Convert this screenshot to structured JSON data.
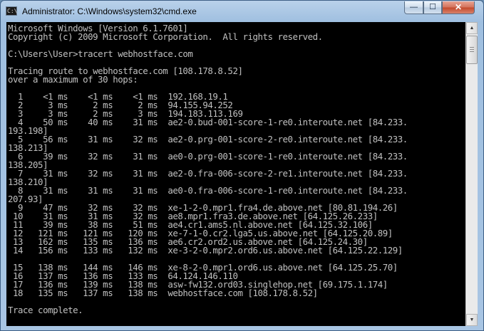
{
  "window": {
    "title": "Administrator: C:\\Windows\\system32\\cmd.exe",
    "icon": "cmd-icon",
    "controls": {
      "minimize": "—",
      "maximize": "☐",
      "close": "✕"
    }
  },
  "console": {
    "lines": [
      "Microsoft Windows [Version 6.1.7601]",
      "Copyright (c) 2009 Microsoft Corporation.  All rights reserved.",
      "",
      "C:\\Users\\User>tracert webhostface.com",
      "",
      "Tracing route to webhostface.com [108.178.8.52]",
      "over a maximum of 30 hops:",
      "",
      "  1    <1 ms    <1 ms    <1 ms  192.168.19.1",
      "  2     3 ms     2 ms     2 ms  94.155.94.252",
      "  3     3 ms     2 ms     3 ms  194.183.113.169",
      "  4    50 ms    40 ms    31 ms  ae2-0.bud-001-score-1-re0.interoute.net [84.233.",
      "193.198]",
      "  5    56 ms    31 ms    32 ms  ae2-0.prg-001-score-2-re0.interoute.net [84.233.",
      "138.213]",
      "  6    39 ms    32 ms    31 ms  ae0-0.prg-001-score-1-re0.interoute.net [84.233.",
      "138.205]",
      "  7    31 ms    32 ms    31 ms  ae2-0.fra-006-score-2-re1.interoute.net [84.233.",
      "138.210]",
      "  8    31 ms    31 ms    31 ms  ae0-0.fra-006-score-1-re0.interoute.net [84.233.",
      "207.93]",
      "  9    47 ms    32 ms    32 ms  xe-1-2-0.mpr1.fra4.de.above.net [80.81.194.26]",
      " 10    31 ms    31 ms    32 ms  ae8.mpr1.fra3.de.above.net [64.125.26.233]",
      " 11    39 ms    38 ms    51 ms  ae4.cr1.ams5.nl.above.net [64.125.32.106]",
      " 12   121 ms   121 ms   120 ms  xe-7-1-0.cr2.lga5.us.above.net [64.125.20.89]",
      " 13   162 ms   135 ms   136 ms  ae6.cr2.ord2.us.above.net [64.125.24.30]",
      " 14   156 ms   133 ms   132 ms  xe-3-2-0.mpr2.ord6.us.above.net [64.125.22.129]",
      "",
      " 15   138 ms   144 ms   146 ms  xe-8-2-0.mpr1.ord6.us.above.net [64.125.25.70]",
      " 16   137 ms   136 ms   133 ms  64.124.146.110",
      " 17   136 ms   139 ms   138 ms  asw-fw132.ord03.singlehop.net [69.175.1.174]",
      " 18   135 ms   137 ms   138 ms  webhostface.com [108.178.8.52]",
      "",
      "Trace complete."
    ]
  },
  "scrollbar": {
    "up_icon": "▲",
    "down_icon": "▼"
  }
}
